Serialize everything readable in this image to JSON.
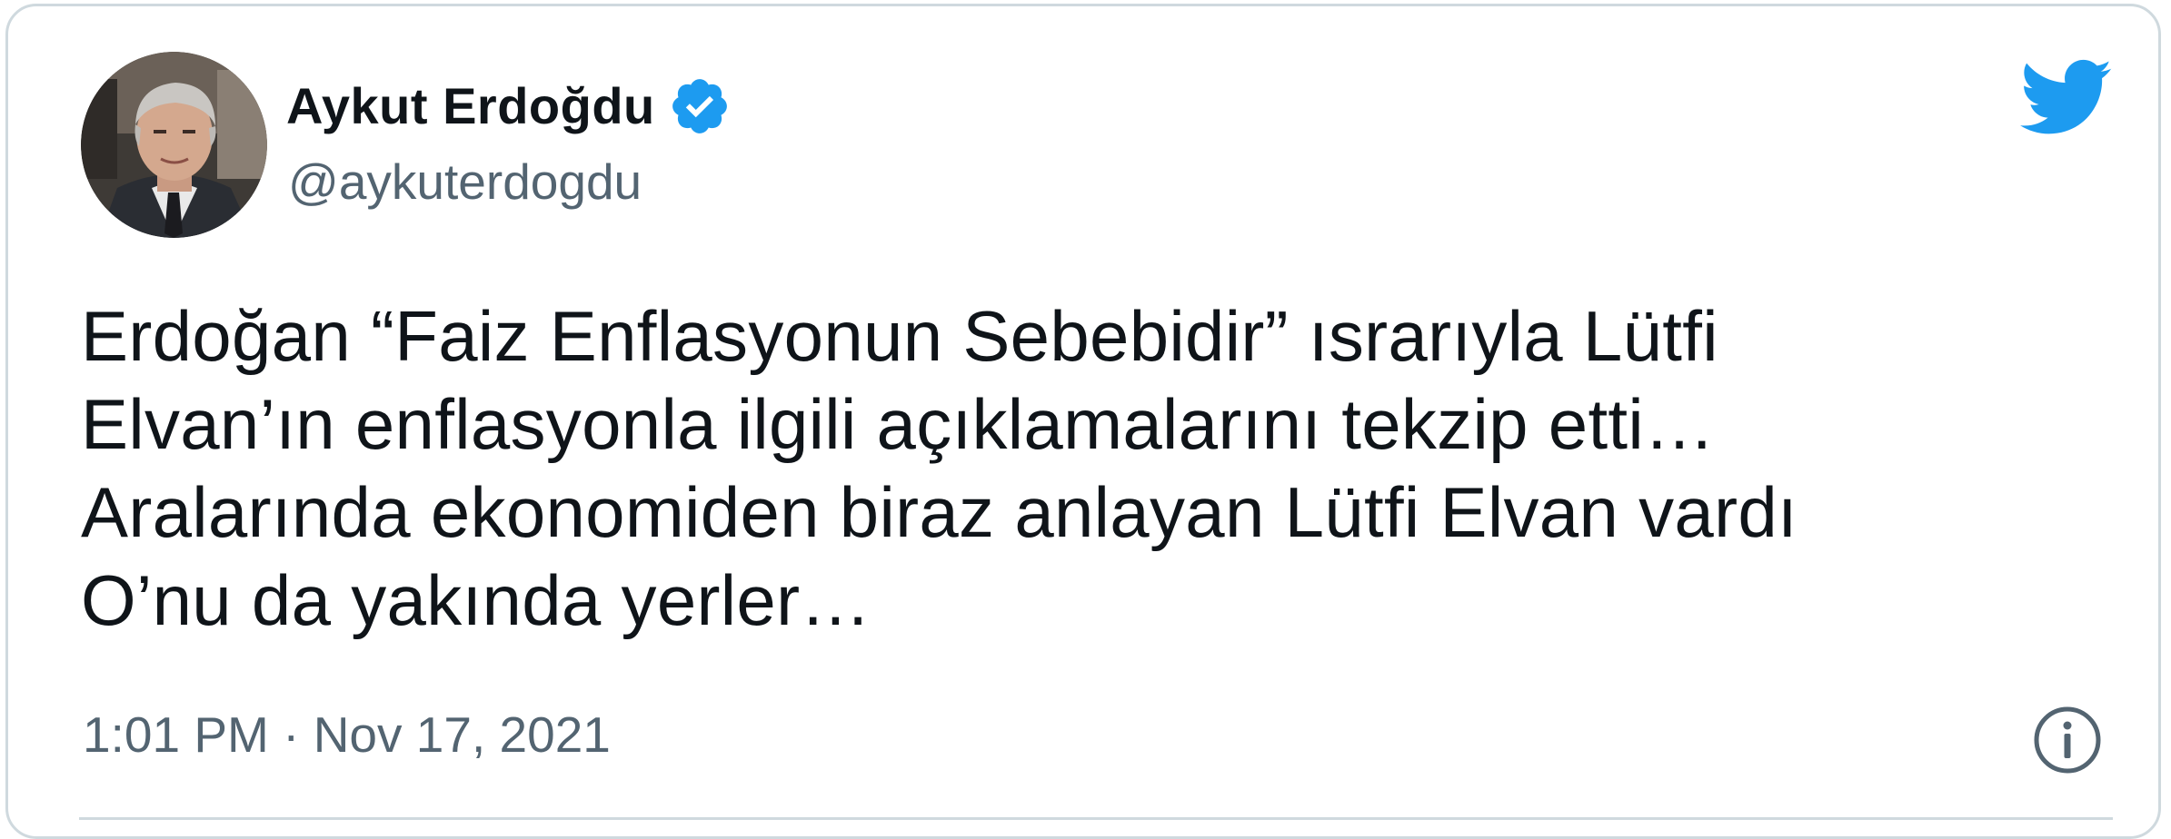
{
  "author": {
    "display_name": "Aykut Erdoğdu",
    "handle": "@aykuterdogdu",
    "verified": true
  },
  "tweet": {
    "text": "Erdoğan “Faiz Enflasyonun Sebebidir” ısrarıyla Lütfi\nElvan’ın enflasyonla ilgili açıklamalarını tekzip etti…\nAralarında ekonomiden biraz anlayan Lütfi Elvan vardı\nO’nu da yakında yerler…",
    "timestamp": "1:01 PM · Nov 17, 2021"
  },
  "icons": {
    "brand": "twitter-bird-icon",
    "verified": "verified-badge-icon",
    "info": "info-icon"
  },
  "colors": {
    "twitter_blue": "#1d9bf0",
    "text_primary": "#0f1419",
    "text_secondary": "#536471",
    "border": "#cfd9de"
  }
}
